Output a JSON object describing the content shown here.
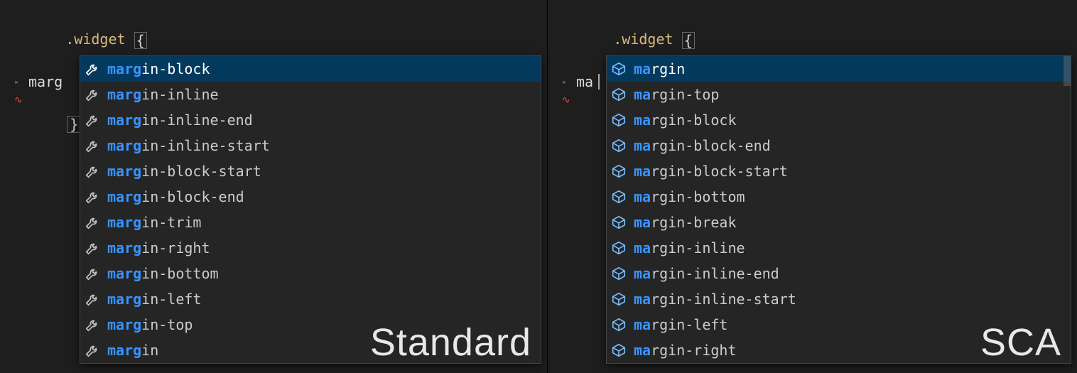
{
  "left": {
    "title": "Standard",
    "selector": ".widget",
    "open_brace": "{",
    "close_brace": "}",
    "query": "marg",
    "match_len": 4,
    "icon": "wrench",
    "suggestions": [
      "margin-block",
      "margin-inline",
      "margin-inline-end",
      "margin-inline-start",
      "margin-block-start",
      "margin-block-end",
      "margin-trim",
      "margin-right",
      "margin-bottom",
      "margin-left",
      "margin-top",
      "margin"
    ],
    "selected_index": 0
  },
  "right": {
    "title": "SCA",
    "selector": ".widget",
    "open_brace": "{",
    "close_brace": "}",
    "query": "ma",
    "match_len": 2,
    "icon": "package",
    "suggestions": [
      "margin",
      "margin-top",
      "margin-block",
      "margin-block-end",
      "margin-block-start",
      "margin-bottom",
      "margin-break",
      "margin-inline",
      "margin-inline-end",
      "margin-inline-start",
      "margin-left",
      "margin-right"
    ],
    "selected_index": 0
  }
}
